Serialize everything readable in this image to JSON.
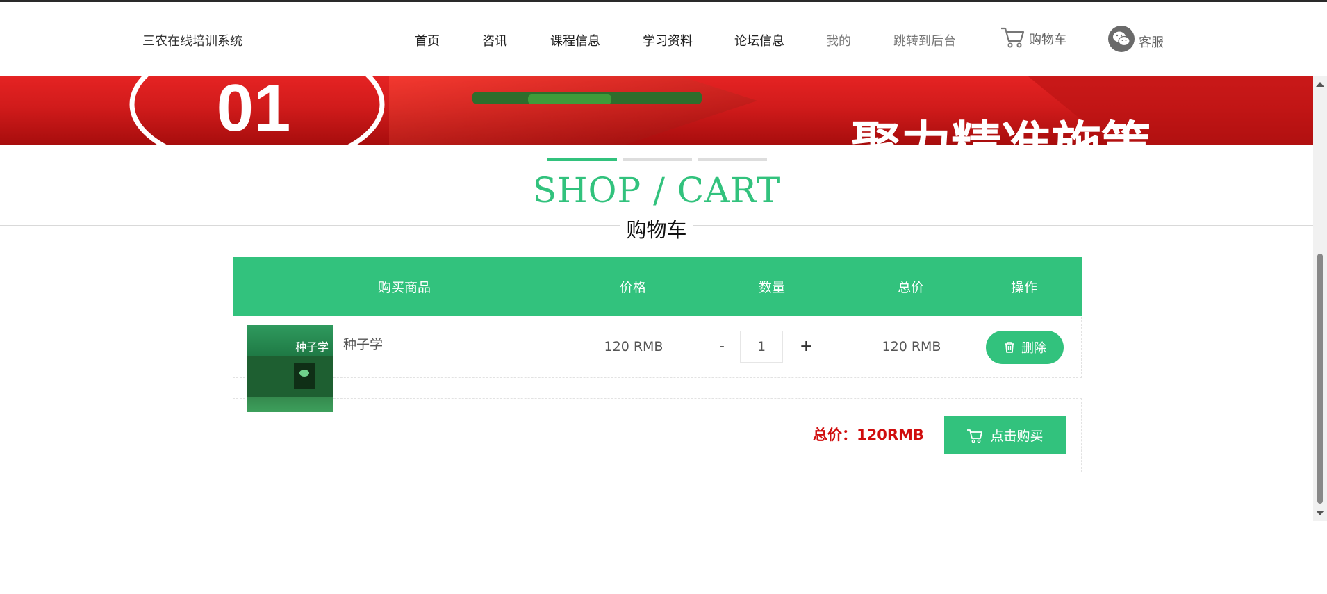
{
  "header": {
    "brand": "三农在线培训系统",
    "nav": [
      "首页",
      "咨讯",
      "课程信息",
      "学习资料",
      "论坛信息",
      "我的",
      "跳转到后台"
    ],
    "cart_label": "购物车",
    "service_label": "客服"
  },
  "banner": {
    "number": "01",
    "slogan": "聚力精准施策"
  },
  "section": {
    "title": "SHOP / CART",
    "subtitle": "购物车"
  },
  "table": {
    "headers": [
      "购买商品",
      "价格",
      "数量",
      "总价",
      "操作"
    ],
    "rows": [
      {
        "product_name": "种子学",
        "cover_title": "种子学",
        "price": "120 RMB",
        "minus": "-",
        "quantity": "1",
        "plus": "+",
        "total": "120 RMB",
        "delete_label": "删除"
      }
    ]
  },
  "summary": {
    "total": "总价：120RMB",
    "buy_label": "点击购买"
  },
  "colors": {
    "accent": "#32c27d",
    "price_red": "#d00d0d",
    "banner_red": "#d11b1b"
  }
}
